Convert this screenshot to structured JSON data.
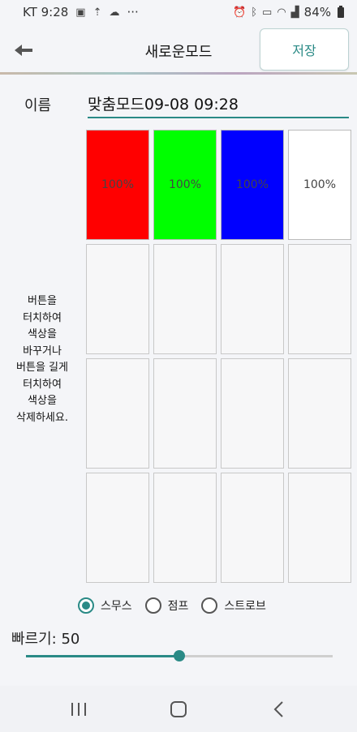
{
  "status_bar": {
    "carrier_time": "KT 9:28",
    "dots": "···",
    "battery": "84%"
  },
  "header": {
    "title": "새로운모드",
    "save_label": "저장",
    "back_icon": "back-arrow-icon"
  },
  "form": {
    "name_label": "이름",
    "name_value": "맞춤모드09-08 09:28"
  },
  "grid": {
    "cells": [
      {
        "label": "100%",
        "color": "#ff0000"
      },
      {
        "label": "100%",
        "color": "#00ff00"
      },
      {
        "label": "100%",
        "color": "#0000ff"
      },
      {
        "label": "100%",
        "color": "#ffffff"
      },
      {
        "label": "",
        "color": ""
      },
      {
        "label": "",
        "color": ""
      },
      {
        "label": "",
        "color": ""
      },
      {
        "label": "",
        "color": ""
      },
      {
        "label": "",
        "color": ""
      },
      {
        "label": "",
        "color": ""
      },
      {
        "label": "",
        "color": ""
      },
      {
        "label": "",
        "color": ""
      },
      {
        "label": "",
        "color": ""
      },
      {
        "label": "",
        "color": ""
      },
      {
        "label": "",
        "color": ""
      },
      {
        "label": "",
        "color": ""
      }
    ],
    "hint_lines": [
      "버튼을",
      "터치하여",
      "색상을",
      "바꾸거나",
      "버튼을 길게",
      "터치하여",
      "색상을",
      "삭제하세요."
    ]
  },
  "modes": {
    "options": [
      {
        "label": "스무스",
        "checked": true
      },
      {
        "label": "점프",
        "checked": false
      },
      {
        "label": "스트로브",
        "checked": false
      }
    ]
  },
  "speed": {
    "label": "빠르기: 50",
    "value": 50,
    "max": 100
  },
  "colors": {
    "accent": "#2a8a86"
  }
}
